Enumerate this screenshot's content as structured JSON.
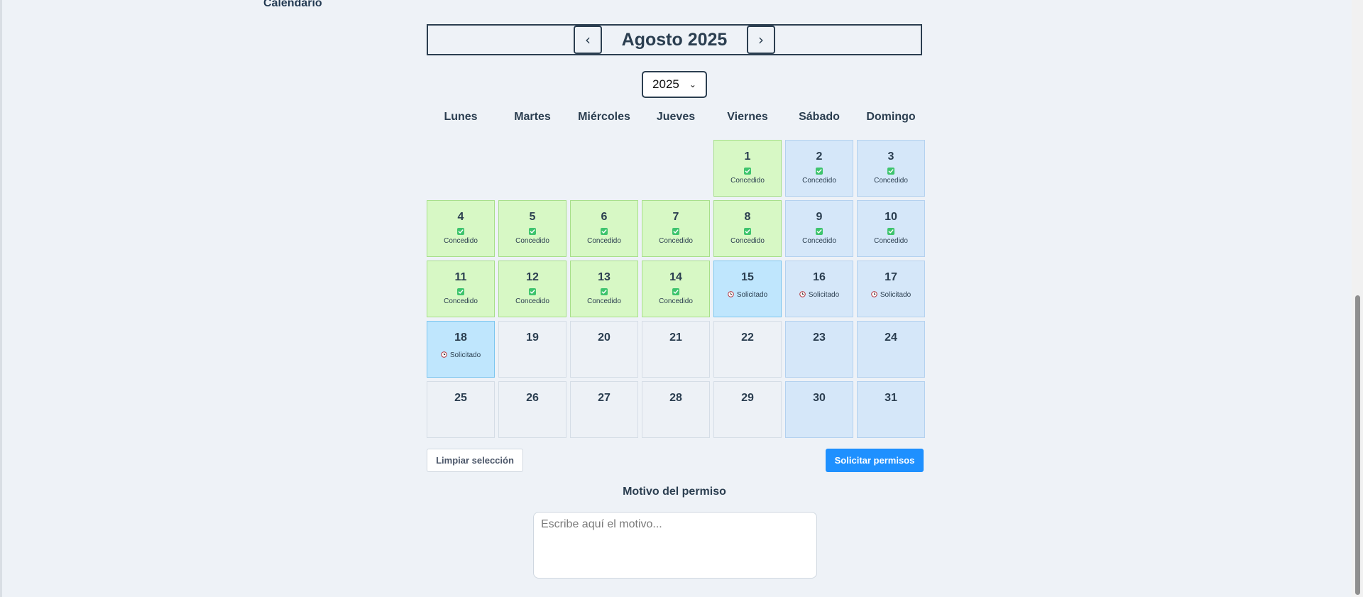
{
  "section_title": "Calendario",
  "calendar": {
    "month_title": "Agosto 2025",
    "prev_label": "‹",
    "next_label": "›",
    "year_select": {
      "value": "2025",
      "options": [
        "2025"
      ]
    },
    "weekdays": [
      "Lunes",
      "Martes",
      "Miércoles",
      "Jueves",
      "Viernes",
      "Sábado",
      "Domingo"
    ],
    "leading_empty_days": 4,
    "days": [
      {
        "day": "1",
        "status": "Concedido",
        "weekend": false
      },
      {
        "day": "2",
        "status": "Concedido",
        "weekend": true
      },
      {
        "day": "3",
        "status": "Concedido",
        "weekend": true
      },
      {
        "day": "4",
        "status": "Concedido",
        "weekend": false
      },
      {
        "day": "5",
        "status": "Concedido",
        "weekend": false
      },
      {
        "day": "6",
        "status": "Concedido",
        "weekend": false
      },
      {
        "day": "7",
        "status": "Concedido",
        "weekend": false
      },
      {
        "day": "8",
        "status": "Concedido",
        "weekend": false
      },
      {
        "day": "9",
        "status": "Concedido",
        "weekend": true
      },
      {
        "day": "10",
        "status": "Concedido",
        "weekend": true
      },
      {
        "day": "11",
        "status": "Concedido",
        "weekend": false
      },
      {
        "day": "12",
        "status": "Concedido",
        "weekend": false
      },
      {
        "day": "13",
        "status": "Concedido",
        "weekend": false
      },
      {
        "day": "14",
        "status": "Concedido",
        "weekend": false
      },
      {
        "day": "15",
        "status": "Solicitado",
        "weekend": false
      },
      {
        "day": "16",
        "status": "Solicitado",
        "weekend": true
      },
      {
        "day": "17",
        "status": "Solicitado",
        "weekend": true
      },
      {
        "day": "18",
        "status": "Solicitado",
        "weekend": false
      },
      {
        "day": "19",
        "status": "",
        "weekend": false
      },
      {
        "day": "20",
        "status": "",
        "weekend": false
      },
      {
        "day": "21",
        "status": "",
        "weekend": false
      },
      {
        "day": "22",
        "status": "",
        "weekend": false
      },
      {
        "day": "23",
        "status": "",
        "weekend": true
      },
      {
        "day": "24",
        "status": "",
        "weekend": true
      },
      {
        "day": "25",
        "status": "",
        "weekend": false
      },
      {
        "day": "26",
        "status": "",
        "weekend": false
      },
      {
        "day": "27",
        "status": "",
        "weekend": false
      },
      {
        "day": "28",
        "status": "",
        "weekend": false
      },
      {
        "day": "29",
        "status": "",
        "weekend": false
      },
      {
        "day": "30",
        "status": "",
        "weekend": true
      },
      {
        "day": "31",
        "status": "",
        "weekend": true
      }
    ]
  },
  "actions": {
    "clear_label": "Limpiar selección",
    "request_label": "Solicitar permisos"
  },
  "reason": {
    "label": "Motivo del permiso",
    "placeholder": "Escribe aquí el motivo...",
    "value": ""
  },
  "colors": {
    "granted_bg": "#d7f8c5",
    "requested_bg": "#bfe6fd",
    "weekend_bg": "#d5e7f9",
    "accent": "#1e90ff"
  }
}
